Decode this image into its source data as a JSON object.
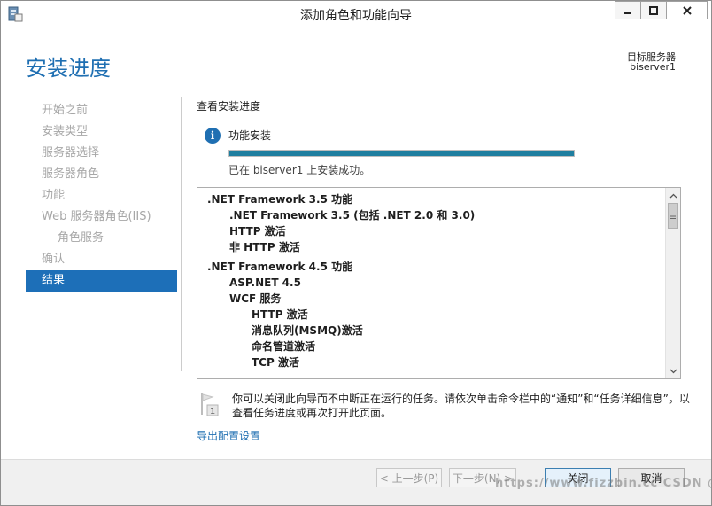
{
  "window": {
    "title": "添加角色和功能向导"
  },
  "header": {
    "page_title": "安装进度",
    "target_label": "目标服务器",
    "target_server": "biserver1"
  },
  "nav": {
    "items": [
      {
        "label": "开始之前",
        "state": "disabled"
      },
      {
        "label": "安装类型",
        "state": "disabled"
      },
      {
        "label": "服务器选择",
        "state": "disabled"
      },
      {
        "label": "服务器角色",
        "state": "disabled"
      },
      {
        "label": "功能",
        "state": "disabled"
      },
      {
        "label": "Web 服务器角色(IIS)",
        "state": "disabled"
      },
      {
        "label": "角色服务",
        "state": "disabled",
        "sub": true
      },
      {
        "label": "确认",
        "state": "disabled"
      },
      {
        "label": "结果",
        "state": "active"
      }
    ]
  },
  "main": {
    "section_heading": "查看安装进度",
    "status_title": "功能安装",
    "progress_fraction": 1.0,
    "status_message": "已在 biserver1 上安装成功。",
    "features": [
      {
        "label": ".NET Framework 3.5 功能",
        "level": 1
      },
      {
        "label": ".NET Framework 3.5 (包括 .NET 2.0 和 3.0)",
        "level": 2
      },
      {
        "label": "HTTP 激活",
        "level": 2
      },
      {
        "label": "非 HTTP 激活",
        "level": 2
      },
      {
        "label": ".NET Framework 4.5 功能",
        "level": 1,
        "gap": true
      },
      {
        "label": "ASP.NET 4.5",
        "level": 2
      },
      {
        "label": "WCF 服务",
        "level": 2
      },
      {
        "label": "HTTP 激活",
        "level": 3
      },
      {
        "label": "消息队列(MSMQ)激活",
        "level": 3
      },
      {
        "label": "命名管道激活",
        "level": 3
      },
      {
        "label": "TCP 激活",
        "level": 3
      }
    ],
    "note_badge": "1",
    "note": "你可以关闭此向导而不中断正在运行的任务。请依次单击命令栏中的“通知”和“任务详细信息”，以查看任务进度或再次打开此页面。",
    "export_link": "导出配置设置"
  },
  "footer": {
    "prev_label": "< 上一步(P)",
    "next_label": "下一步(N) >",
    "close_label": "关闭",
    "cancel_label": "取消"
  },
  "watermark": "https://www.fizzbin.cc CSDN @blogwym"
}
